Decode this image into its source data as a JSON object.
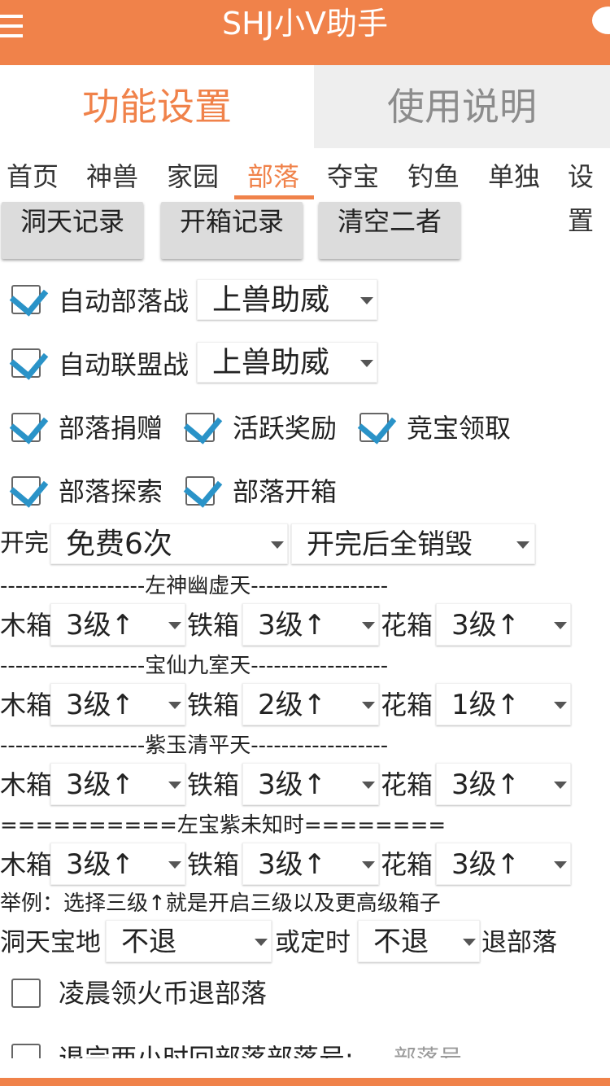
{
  "app": {
    "title": "SHJ小V助手"
  },
  "main_tabs": [
    {
      "label": "功能设置",
      "active": true
    },
    {
      "label": "使用说明",
      "active": false
    }
  ],
  "sub_tabs": [
    "首页",
    "神兽",
    "家园",
    "部落",
    "夺宝",
    "钓鱼",
    "单独",
    "设置"
  ],
  "active_sub_tab": "部落",
  "buttons": [
    "洞天记录",
    "开箱记录",
    "清空二者"
  ],
  "options": {
    "auto_tribe_war": {
      "label": "自动部落战",
      "checked": true,
      "select": "上兽助威"
    },
    "auto_alliance_war": {
      "label": "自动联盟战",
      "checked": true,
      "select": "上兽助威"
    },
    "tribe_donate": {
      "label": "部落捐赠",
      "checked": true
    },
    "active_reward": {
      "label": "活跃奖励",
      "checked": true
    },
    "auction_claim": {
      "label": "竞宝领取",
      "checked": true
    },
    "tribe_explore": {
      "label": "部落探索",
      "checked": true
    },
    "tribe_open_box": {
      "label": "部落开箱",
      "checked": true
    }
  },
  "open_row": {
    "label": "开完",
    "count": "免费6次",
    "after": "开完后全销毁"
  },
  "box_labels": {
    "wood": "木箱",
    "iron": "铁箱",
    "flower": "花箱"
  },
  "sections": [
    {
      "header": "-------------------左神幽虚天------------------",
      "wood": "3级↑",
      "iron": "3级↑",
      "flower": "3级↑"
    },
    {
      "header": "-------------------宝仙九室天------------------",
      "wood": "3级↑",
      "iron": "2级↑",
      "flower": "1级↑"
    },
    {
      "header": "-------------------紫玉清平天------------------",
      "wood": "3级↑",
      "iron": "3级↑",
      "flower": "3级↑"
    },
    {
      "header": "==========左宝紫未知时========",
      "wood": "3级↑",
      "iron": "3级↑",
      "flower": "3级↑"
    }
  ],
  "example_text": "举例：选择三级↑就是开启三级以及更高级箱子",
  "retreat_row": {
    "label1": "洞天宝地",
    "select1": "不退",
    "label2": "或定时",
    "select2": "不退",
    "label3": "退部落"
  },
  "dawn_option": {
    "label": "凌晨领火币退部落",
    "checked": false
  },
  "return_option": {
    "label": "退完两小时回部落部落号:",
    "placeholder": "部落号",
    "checked": false
  },
  "colors": {
    "accent": "#f0824a",
    "check": "#2a93c8",
    "tab_inactive_bg": "#eeeeee"
  }
}
